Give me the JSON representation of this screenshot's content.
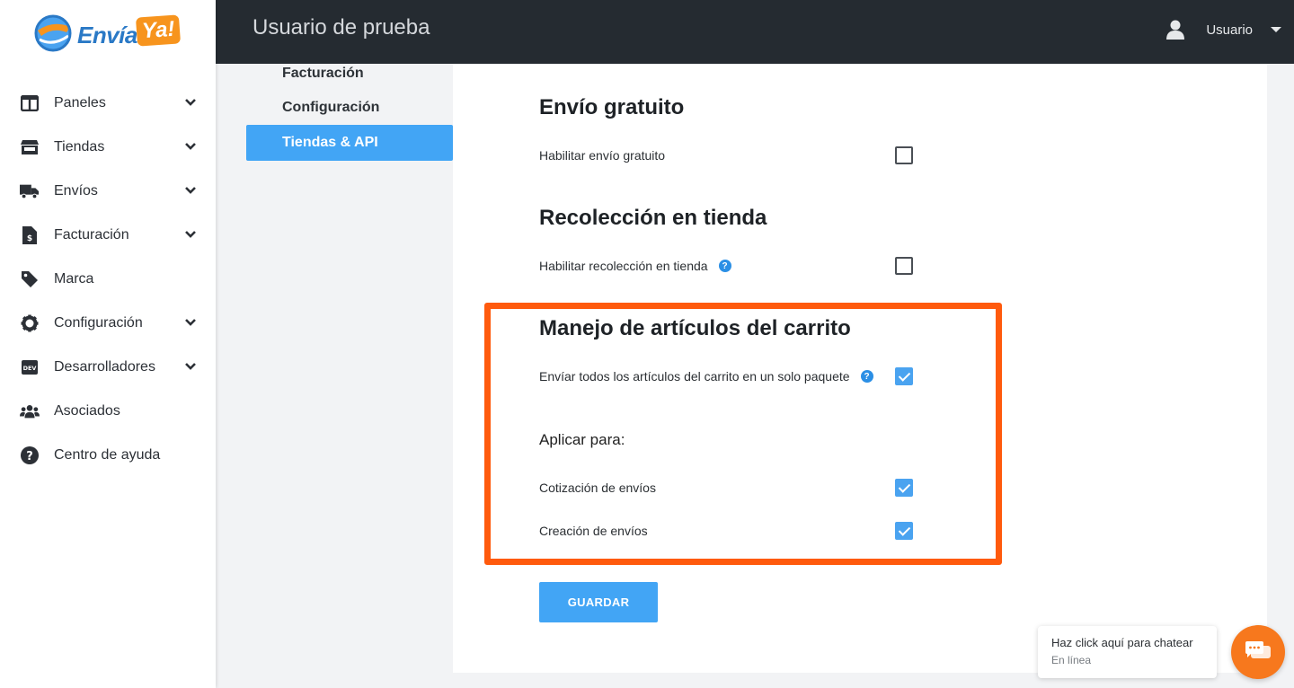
{
  "brand": {
    "logo_text": "Envía",
    "logo_ya": "Ya!"
  },
  "sidebar": {
    "items": [
      {
        "label": "Paneles",
        "icon": "columns-icon",
        "has_chevron": true
      },
      {
        "label": "Tiendas",
        "icon": "store-icon",
        "has_chevron": true
      },
      {
        "label": "Envíos",
        "icon": "truck-icon",
        "has_chevron": true
      },
      {
        "label": "Facturación",
        "icon": "invoice-icon",
        "has_chevron": true
      },
      {
        "label": "Marca",
        "icon": "tag-icon",
        "has_chevron": false
      },
      {
        "label": "Configuración",
        "icon": "gear-icon",
        "has_chevron": true
      },
      {
        "label": "Desarrolladores",
        "icon": "dev-icon",
        "has_chevron": true
      },
      {
        "label": "Asociados",
        "icon": "users-icon",
        "has_chevron": false
      },
      {
        "label": "Centro de ayuda",
        "icon": "question-icon",
        "has_chevron": false
      }
    ]
  },
  "header": {
    "title": "Usuario de prueba",
    "user_label": "Usuario"
  },
  "subnav": {
    "items": [
      {
        "label": "Facturación",
        "active": false
      },
      {
        "label": "Configuración",
        "active": false
      },
      {
        "label": "Tiendas & API",
        "active": true
      }
    ]
  },
  "settings": {
    "free_shipping": {
      "title": "Envío gratuito",
      "enable_label": "Habilitar envío gratuito",
      "checked": false
    },
    "store_pickup": {
      "title": "Recolección en tienda",
      "enable_label": "Habilitar recolección en tienda",
      "checked": false
    },
    "cart": {
      "title": "Manejo de artículos del carrito",
      "single_package_label": "Envíar todos los artículos del carrito en un solo paquete",
      "single_package_checked": true,
      "apply_title": "Aplicar para:",
      "quote_label": "Cotización de envíos",
      "quote_checked": true,
      "creation_label": "Creación de envíos",
      "creation_checked": true
    },
    "save_label": "GUARDAR"
  },
  "chat": {
    "prompt": "Haz click aquí para chatear",
    "status": "En línea"
  },
  "colors": {
    "accent": "#42a5f5",
    "highlight": "#ff5a0d",
    "header_bg": "#252b31",
    "chat": "#f7781d"
  }
}
